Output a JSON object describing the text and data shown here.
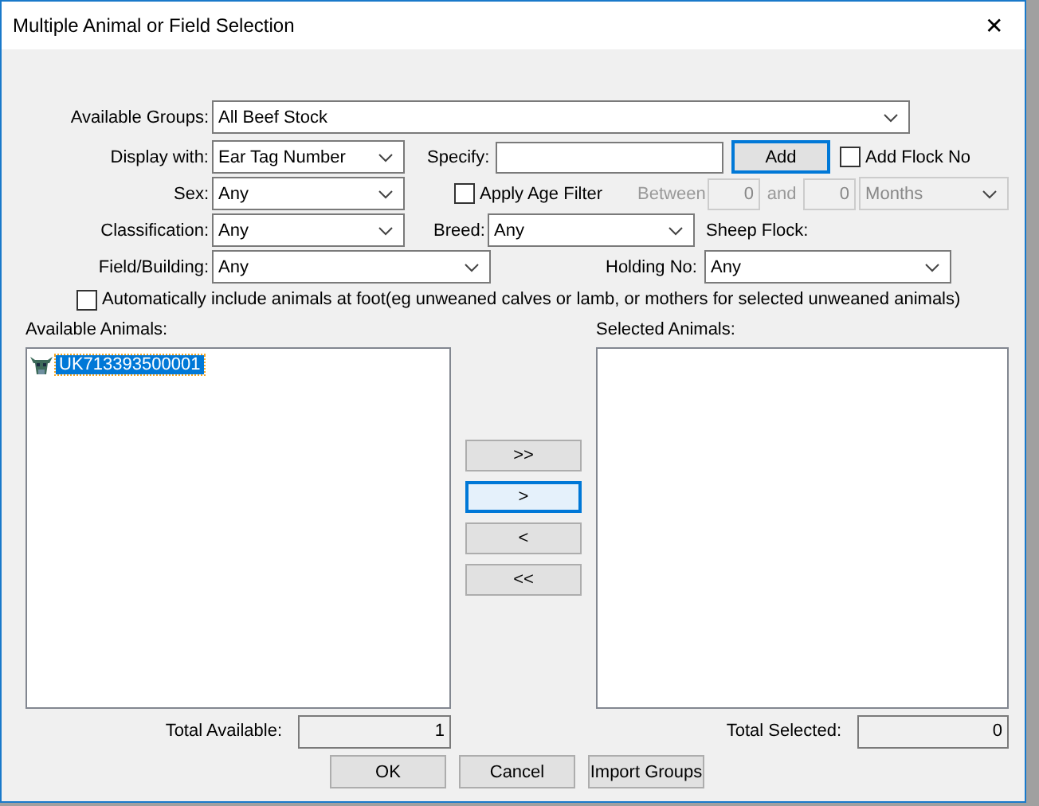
{
  "window": {
    "title": "Multiple Animal or Field Selection",
    "close": "✕"
  },
  "form": {
    "available_groups": {
      "label": "Available Groups:",
      "value": "All Beef Stock"
    },
    "display_with": {
      "label": "Display with:",
      "value": "Ear Tag Number"
    },
    "specify": {
      "label": "Specify:"
    },
    "add_button": {
      "label": "Add",
      "focused": true
    },
    "add_flock_no": {
      "label": "Add Flock No",
      "checked": false
    },
    "sex": {
      "label": "Sex:",
      "value": "Any"
    },
    "apply_age_filter": {
      "label": "Apply Age Filter",
      "checked": false
    },
    "age_range": {
      "label": "Between",
      "from": "0",
      "and_label": "and",
      "to": "0",
      "unit": "Months",
      "disabled": true
    },
    "classification": {
      "label": "Classification:",
      "value": "Any"
    },
    "breed": {
      "label": "Breed:",
      "value": "Any"
    },
    "sheep_flock": {
      "label": "Sheep Flock:"
    },
    "field_building": {
      "label": "Field/Building:",
      "value": "Any"
    },
    "holding_no": {
      "label": "Holding No:",
      "value": "Any"
    },
    "auto_include": {
      "label": "Automatically include animals at foot(eg unweaned calves or lamb, or mothers for selected unweaned animals)",
      "checked": false
    }
  },
  "available_animals": {
    "label": "Available Animals:",
    "items": [
      {
        "tag": "UK713393500001",
        "selected": true
      }
    ]
  },
  "selected_animals": {
    "label": "Selected Animals:"
  },
  "transfer_buttons": [
    {
      "label": ">>",
      "focused": false
    },
    {
      "label": ">",
      "focused": true
    },
    {
      "label": "<",
      "focused": false
    },
    {
      "label": "<<",
      "focused": false
    }
  ],
  "total_available": {
    "label": "Total Available:",
    "value": "1"
  },
  "total_selected": {
    "label": "Total Selected:",
    "value": "0"
  },
  "buttons": [
    "OK",
    "Cancel",
    "Import Groups"
  ]
}
